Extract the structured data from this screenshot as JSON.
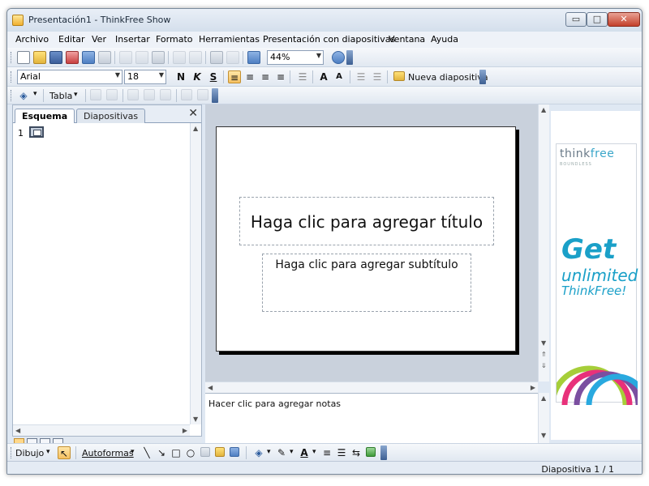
{
  "window": {
    "title": "Presentación1 - ThinkFree Show",
    "minimize": "▭",
    "maximize": "□",
    "close": "✕"
  },
  "menu": [
    "Archivo",
    "Editar",
    "Ver",
    "Insertar",
    "Formato",
    "Herramientas",
    "Presentación con diapositivas",
    "Ventana",
    "Ayuda"
  ],
  "toolbar": {
    "zoom": "44%",
    "font_name": "Arial",
    "font_size": "18",
    "bold": "N",
    "italic": "K",
    "underline": "S",
    "new_slide": "Nueva diapositiva",
    "table": "Tabla"
  },
  "left_pane": {
    "tabs": [
      "Esquema",
      "Diapositivas"
    ],
    "active_tab": "Esquema",
    "close": "✕",
    "slide_number": "1"
  },
  "slide": {
    "title_placeholder": "Haga clic para agregar título",
    "subtitle_placeholder": "Haga clic para agregar subtítulo"
  },
  "notes": {
    "placeholder": "Hacer clic para agregar notas"
  },
  "ad": {
    "logo_think": "think",
    "logo_free": "free",
    "logo_sub": "BOUNDLESS",
    "line1": "Get",
    "line2": "unlimited",
    "line3": "ThinkFree!"
  },
  "draw_toolbar": {
    "draw": "Dibujo",
    "autoshapes": "Autoformas"
  },
  "status": {
    "slide_info": "Diapositiva 1 / 1"
  },
  "colors": {
    "ad_accent": "#1aa0c8",
    "window_bg": "#dfe8f3",
    "canvas_bg": "#c9d1dc"
  }
}
